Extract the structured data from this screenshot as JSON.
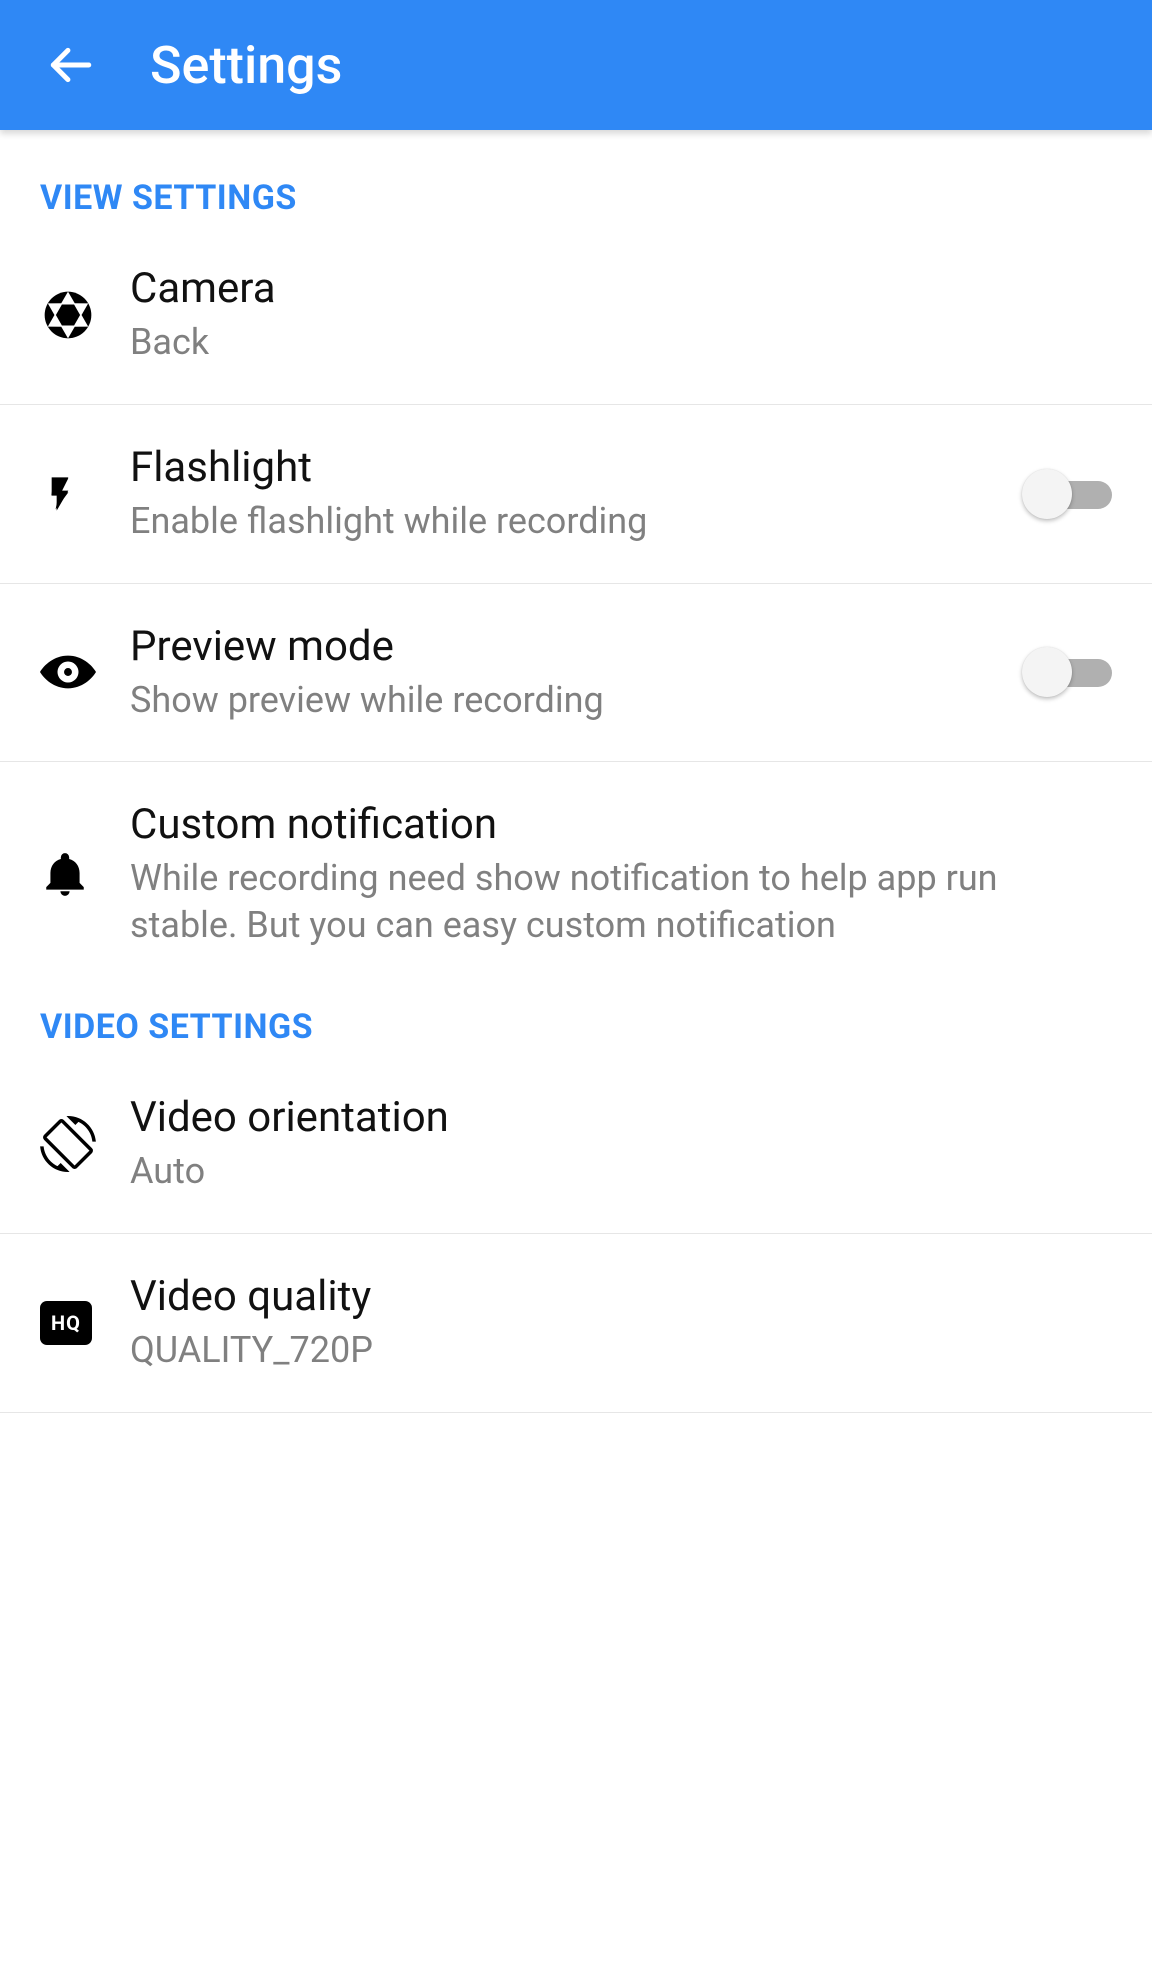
{
  "header": {
    "title": "Settings"
  },
  "sections": {
    "view": {
      "header": "VIEW SETTINGS",
      "camera": {
        "title": "Camera",
        "value": "Back"
      },
      "flashlight": {
        "title": "Flashlight",
        "subtitle": "Enable flashlight while recording",
        "enabled": false
      },
      "preview": {
        "title": "Preview mode",
        "subtitle": "Show preview while recording",
        "enabled": false
      },
      "notification": {
        "title": "Custom notification",
        "subtitle": "While recording need show notification to help app run stable. But you can easy custom notification"
      }
    },
    "video": {
      "header": "VIDEO SETTINGS",
      "orientation": {
        "title": "Video orientation",
        "value": "Auto"
      },
      "quality": {
        "title": "Video quality",
        "value": "QUALITY_720P"
      }
    }
  }
}
